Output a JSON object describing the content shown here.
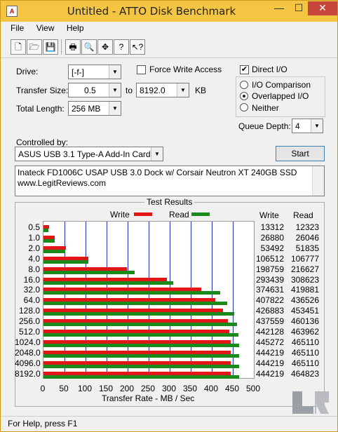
{
  "window": {
    "title": "Untitled - ATTO Disk Benchmark",
    "min": "—",
    "max": "☐",
    "close": "✕"
  },
  "menu": [
    "File",
    "View",
    "Help"
  ],
  "toolbar": [
    "new-icon",
    "open-icon",
    "save-icon",
    "print-icon",
    "print-preview-icon",
    "move-icon",
    "help-icon",
    "context-help-icon"
  ],
  "settings": {
    "drive_label": "Drive:",
    "drive_value": "[-f-]",
    "force_write_label": "Force Write Access",
    "direct_io_label": "Direct I/O",
    "direct_io_checked": true,
    "transfer_size_label": "Transfer Size:",
    "transfer_from": "0.5",
    "to_label": "to",
    "transfer_to": "8192.0",
    "kb_label": "KB",
    "total_length_label": "Total Length:",
    "total_length_value": "256 MB",
    "io_comparison_label": "I/O Comparison",
    "overlapped_io_label": "Overlapped I/O",
    "neither_label": "Neither",
    "queue_depth_label": "Queue Depth:",
    "queue_depth_value": "4",
    "controlled_by_label": "Controlled by:",
    "controlled_by_value": "ASUS USB 3.1 Type-A Add-In Card",
    "start_label": "Start",
    "description_line1": "Inateck FD1006C USAP USB 3.0 Dock w/ Corsair Neutron XT 240GB SSD",
    "description_line2": "www.LegitReviews.com"
  },
  "results": {
    "title": "Test Results",
    "legend_write": "Write",
    "legend_read": "Read",
    "col_write": "Write",
    "col_read": "Read",
    "xlabel": "Transfer Rate - MB / Sec",
    "write_color": "#e21616",
    "read_color": "#1a8a1a",
    "grid_color": "#2233bb"
  },
  "status": "For Help, press F1",
  "chart_data": {
    "type": "bar",
    "categories": [
      "0.5",
      "1.0",
      "2.0",
      "4.0",
      "8.0",
      "16.0",
      "32.0",
      "64.0",
      "128.0",
      "256.0",
      "512.0",
      "1024.0",
      "2048.0",
      "4096.0",
      "8192.0"
    ],
    "series": [
      {
        "name": "Write",
        "values": [
          13312,
          26880,
          53492,
          106512,
          198759,
          293439,
          374631,
          407822,
          426883,
          437559,
          442128,
          445272,
          444219,
          444219,
          444219
        ]
      },
      {
        "name": "Read",
        "values": [
          12323,
          26046,
          51835,
          106777,
          216627,
          308623,
          419881,
          436526,
          453451,
          460136,
          463962,
          465110,
          465110,
          465110,
          464823
        ]
      }
    ],
    "xlim": [
      0,
      500
    ],
    "xticks": [
      "0",
      "50",
      "100",
      "150",
      "200",
      "250",
      "300",
      "350",
      "400",
      "450",
      "500"
    ],
    "xlabel": "Transfer Rate - MB / Sec",
    "grid": true
  }
}
